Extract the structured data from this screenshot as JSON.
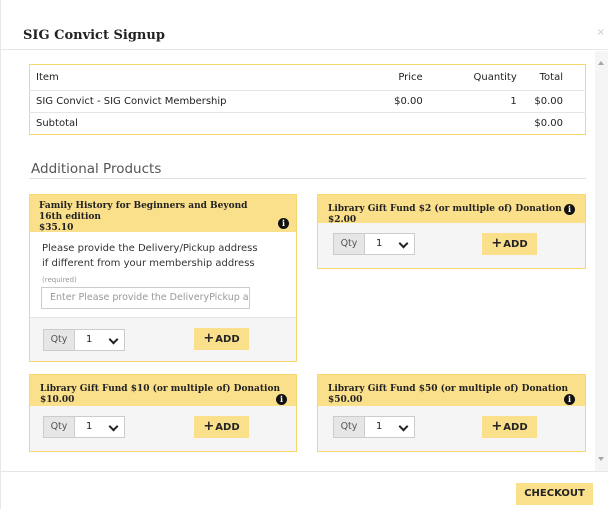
{
  "dialog": {
    "title": "SIG Convict Signup",
    "close_glyph": "×"
  },
  "cart": {
    "headers": [
      "Item",
      "Price",
      "Quantity",
      "Total"
    ],
    "rows": [
      {
        "item": "SIG Convict - SIG Convict Membership",
        "price": "$0.00",
        "quantity": "1",
        "total": "$0.00"
      }
    ],
    "subtotal_label": "Subtotal",
    "subtotal_value": "$0.00"
  },
  "additional": {
    "title": "Additional Products",
    "products": [
      {
        "title": "Family History for Beginners and Beyond 16th edition",
        "price": "$35.10",
        "description": "Please provide the Delivery/Pickup address if different from your membership address",
        "required_note": "(required)",
        "input_placeholder": "Enter Please provide the DeliveryPickup address if different from your membership address",
        "qty_label": "Qty",
        "qty_value": "1",
        "add_label": "ADD"
      },
      {
        "title": "Library Gift Fund $2 (or multiple of) Donation",
        "price": "$2.00",
        "qty_label": "Qty",
        "qty_value": "1",
        "add_label": "ADD"
      },
      {
        "title": "Library Gift Fund $10 (or multiple of) Donation",
        "price": "$10.00",
        "qty_label": "Qty",
        "qty_value": "1",
        "add_label": "ADD"
      },
      {
        "title": "Library Gift Fund $50 (or multiple of) Donation",
        "price": "$50.00",
        "qty_label": "Qty",
        "qty_value": "1",
        "add_label": "ADD"
      }
    ]
  },
  "footer": {
    "checkout_label": "CHECKOUT"
  },
  "icons": {
    "info": "info-circle-icon",
    "plus": "plus-icon",
    "chevron": "chevron-down-icon",
    "close": "close-icon"
  },
  "colors": {
    "accent": "#fbe08c",
    "accent_border": "#f5d76e",
    "footer_panel": "#f5f5f5"
  }
}
